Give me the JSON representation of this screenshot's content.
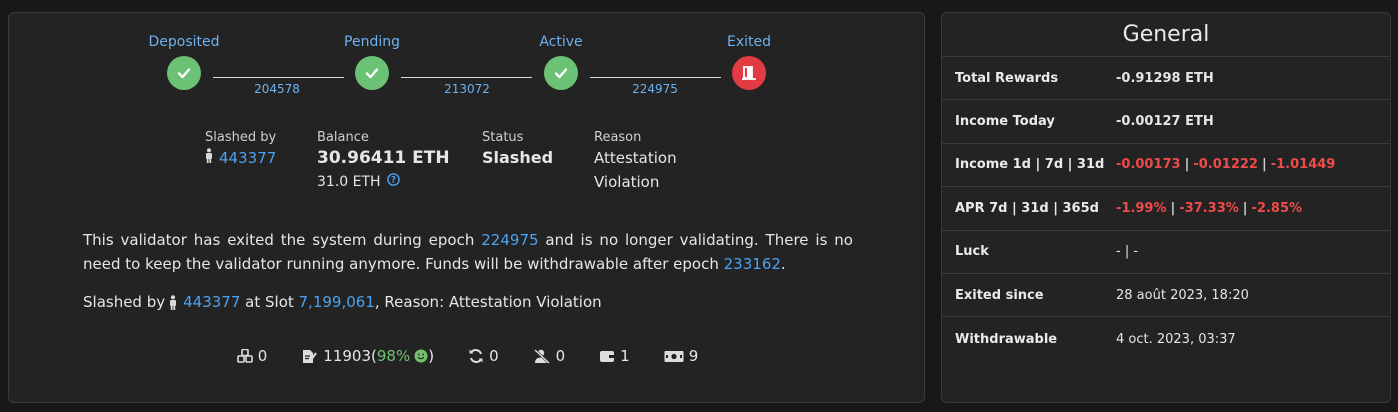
{
  "stepper": {
    "steps": [
      {
        "label": "Deposited",
        "state": "done"
      },
      {
        "label": "Pending",
        "state": "done"
      },
      {
        "label": "Active",
        "state": "done"
      },
      {
        "label": "Exited",
        "state": "exited"
      }
    ],
    "epochs": [
      "204578",
      "213072",
      "224975"
    ]
  },
  "info": {
    "slashed_by_label": "Slashed by",
    "slashed_by_value": "443377",
    "balance_label": "Balance",
    "balance_value": "30.96411 ETH",
    "effective_balance": "31.0 ETH",
    "status_label": "Status",
    "status_value": "Slashed",
    "reason_label": "Reason",
    "reason_line1": "Attestation",
    "reason_line2": "Violation"
  },
  "message": {
    "part1": "This validator has exited the system during epoch ",
    "exit_epoch": "224975",
    "part2": " and is no longer validating. There is no need to keep the validator running anymore. Funds will be withdrawable after epoch ",
    "withdraw_epoch": "233162",
    "part3": "."
  },
  "slash_line": {
    "prefix": "Slashed by",
    "validator": "443377",
    "at_slot": " at Slot ",
    "slot": "7,199,061",
    "reason": ", Reason: Attestation Violation"
  },
  "stats": {
    "proposals": "0",
    "attestations": "11903",
    "attestation_pct": "98%",
    "sync": "0",
    "slashings": "0",
    "deposits": "1",
    "withdrawals": "9"
  },
  "general": {
    "title": "General",
    "total_rewards_label": "Total Rewards",
    "total_rewards": "-0.91298 ETH",
    "income_today_label": "Income Today",
    "income_today": "-0.00127 ETH",
    "income_label": "Income 1d | 7d | 31d",
    "income_1d": "-0.00173",
    "income_7d": "-0.01222",
    "income_31d": "-1.01449",
    "apr_label": "APR 7d | 31d | 365d",
    "apr_7d": "-1.99%",
    "apr_31d": "-37.33%",
    "apr_365d": "-2.85%",
    "luck_label": "Luck",
    "luck_value": "- | -",
    "exited_label": "Exited since",
    "exited_value": "28 août 2023, 18:20",
    "withdrawable_label": "Withdrawable",
    "withdrawable_value": "4 oct. 2023, 03:37"
  },
  "colors": {
    "done": "#6cc274",
    "exited": "#e23b43",
    "link": "#4aa3f0",
    "negative": "#ef4b4b"
  }
}
